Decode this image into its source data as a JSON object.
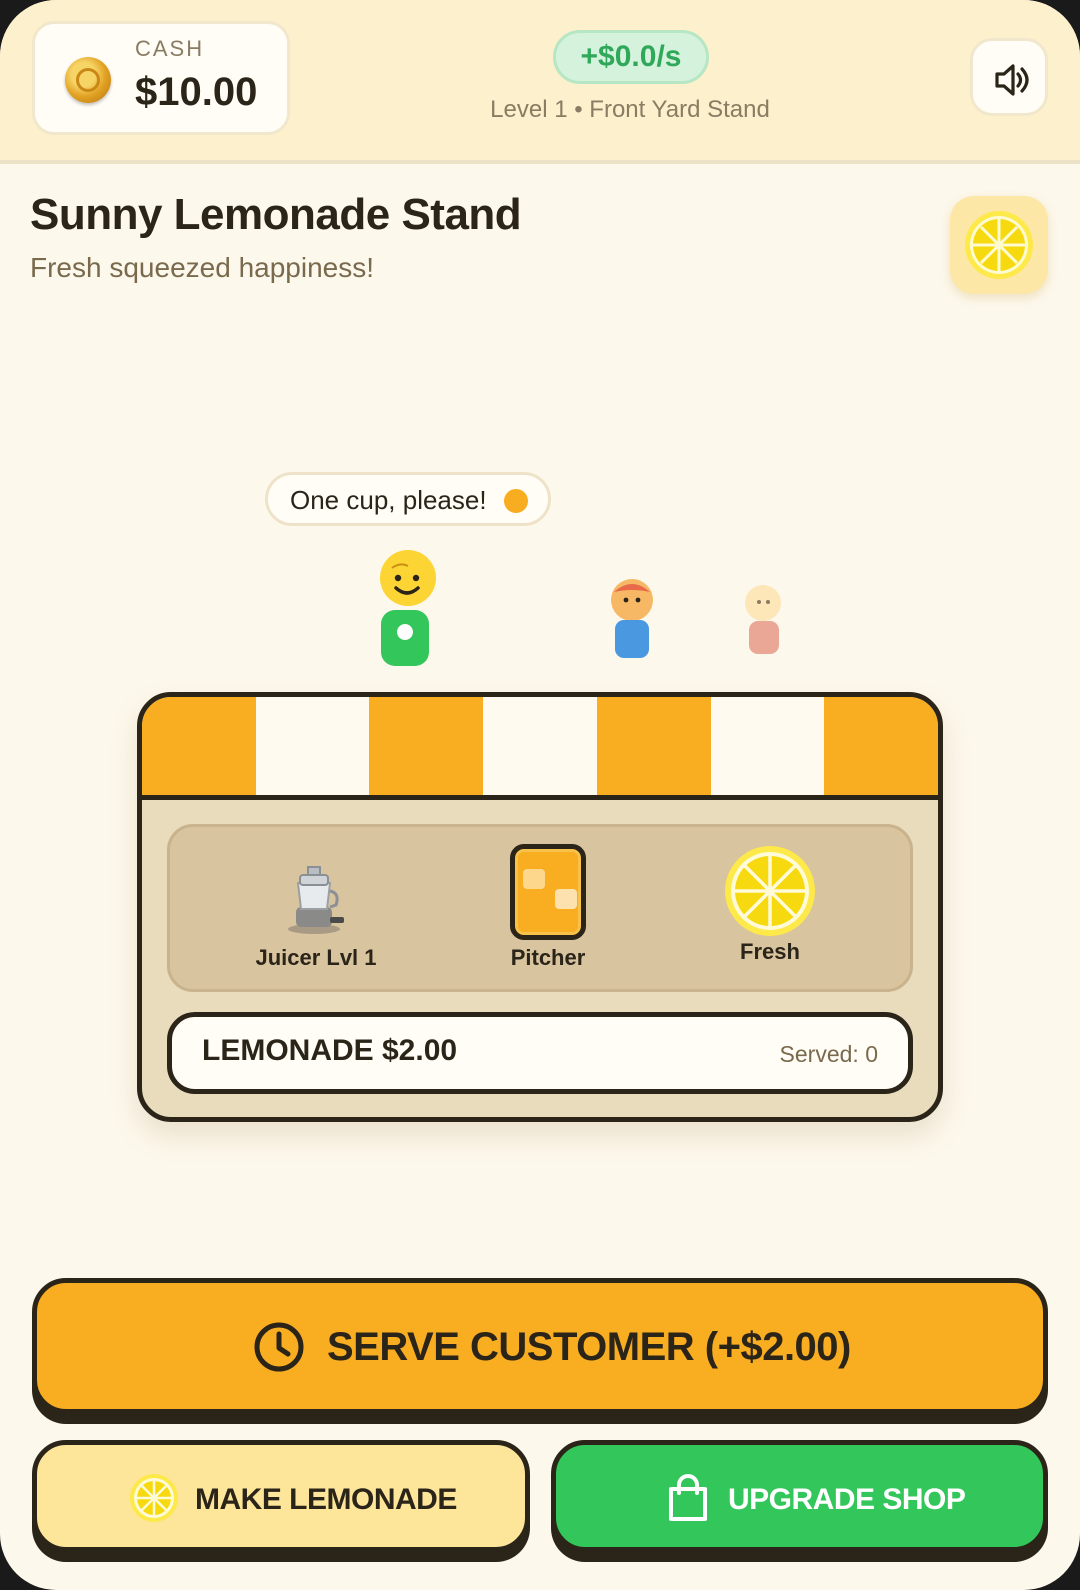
{
  "header": {
    "cash_label": "CASH",
    "cash_value": "$10.00",
    "income_rate": "+$0.0/s",
    "level_line": "Level 1 • Front Yard Stand",
    "icons": {
      "coin": "coin-icon",
      "sound": "speaker-icon"
    }
  },
  "stand_info": {
    "title": "Sunny Lemonade Stand",
    "subtitle": "Fresh squeezed happiness!",
    "badge_icon": "lemon-icon"
  },
  "customers": {
    "speech": "One cup, please!",
    "queue_count": 3
  },
  "stand": {
    "equipment": [
      {
        "label": "Juicer Lvl 1",
        "icon": "juicer-icon"
      },
      {
        "label": "Pitcher",
        "icon": "pitcher-icon"
      },
      {
        "label": "Fresh",
        "icon": "lemon-slice-icon"
      }
    ],
    "product": "LEMONADE $2.00",
    "served": "Served: 0"
  },
  "actions": {
    "serve_label": "SERVE CUSTOMER (+$2.00)",
    "make_label": "MAKE LEMONADE",
    "upgrade_label": "UPGRADE SHOP"
  },
  "colors": {
    "accent_orange": "#f9ad21",
    "accent_green": "#33c65a",
    "cream": "#fde59a",
    "ink": "#2b2418"
  }
}
